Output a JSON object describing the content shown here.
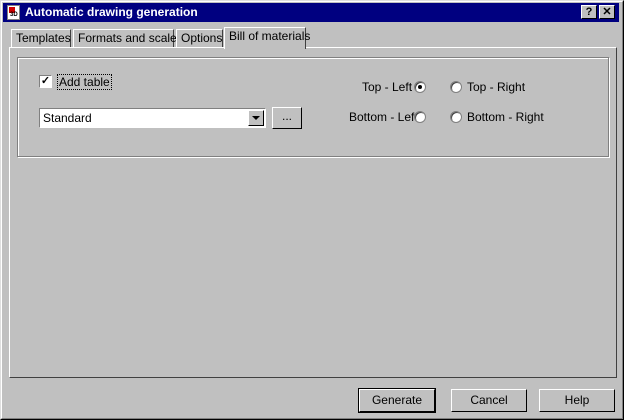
{
  "window": {
    "title": "Automatic drawing generation",
    "help_btn": "?",
    "close_btn": "✕"
  },
  "tabs": [
    {
      "label": "Templates",
      "active": false
    },
    {
      "label": "Formats and scales",
      "active": false
    },
    {
      "label": "Options",
      "active": false
    },
    {
      "label": "Bill of materials",
      "active": true
    }
  ],
  "bom": {
    "add_table": {
      "label": "Add table",
      "checked": true,
      "check": "✓"
    },
    "table_style": {
      "value": "Standard"
    },
    "browse_label": "...",
    "position": {
      "top_left": "Top - Left",
      "top_right": "Top - Right",
      "bottom_left": "Bottom - Left",
      "bottom_right": "Bottom - Right",
      "selected": "top_left"
    }
  },
  "buttons": {
    "generate": "Generate",
    "cancel": "Cancel",
    "help": "Help"
  }
}
